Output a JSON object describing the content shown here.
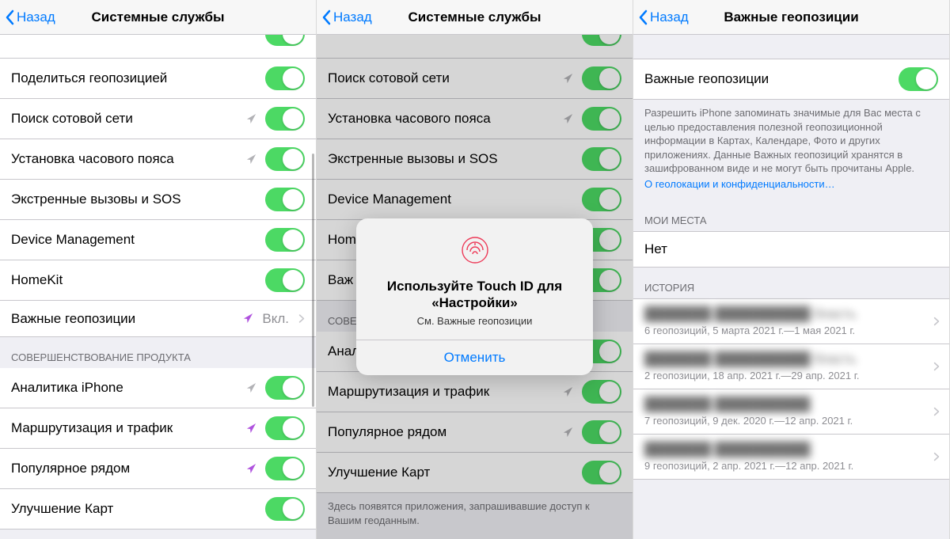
{
  "back_label": "Назад",
  "panel1": {
    "title": "Системные службы",
    "rows": [
      {
        "label": "Поделиться геопозицией",
        "arrow": false,
        "arrowColor": ""
      },
      {
        "label": "Поиск сотовой сети",
        "arrow": true,
        "arrowColor": "gray"
      },
      {
        "label": "Установка часового пояса",
        "arrow": true,
        "arrowColor": "gray"
      },
      {
        "label": "Экстренные вызовы и SOS",
        "arrow": false,
        "arrowColor": ""
      },
      {
        "label": "Device Management",
        "arrow": false,
        "arrowColor": ""
      },
      {
        "label": "HomeKit",
        "arrow": false,
        "arrowColor": ""
      }
    ],
    "significant": {
      "label": "Важные геопозиции",
      "value": "Вкл."
    },
    "section2_header": "СОВЕРШЕНСТВОВАНИЕ ПРОДУКТА",
    "rows2": [
      {
        "label": "Аналитика iPhone",
        "arrow": true,
        "arrowColor": "gray"
      },
      {
        "label": "Маршрутизация и трафик",
        "arrow": true,
        "arrowColor": "purple"
      },
      {
        "label": "Популярное рядом",
        "arrow": true,
        "arrowColor": "purple"
      },
      {
        "label": "Улучшение Карт",
        "arrow": false,
        "arrowColor": ""
      }
    ]
  },
  "panel2": {
    "title": "Системные службы",
    "rows": [
      {
        "label": "Поиск сотовой сети",
        "arrow": true,
        "arrowColor": "gray"
      },
      {
        "label": "Установка часового пояса",
        "arrow": true,
        "arrowColor": "gray"
      },
      {
        "label": "Экстренные вызовы и SOS",
        "arrow": false,
        "arrowColor": ""
      },
      {
        "label": "Device Management",
        "arrow": false,
        "arrowColor": ""
      },
      {
        "label": "Hom",
        "arrow": false,
        "arrowColor": ""
      },
      {
        "label": "Важ",
        "arrow": false,
        "arrowColor": ""
      }
    ],
    "section2_header": "СОВЕ",
    "rows2": [
      {
        "label": "Анал",
        "arrow": false,
        "arrowColor": ""
      },
      {
        "label": "Маршрутизация и трафик",
        "arrow": true,
        "arrowColor": "gray"
      },
      {
        "label": "Популярное рядом",
        "arrow": true,
        "arrowColor": "gray"
      },
      {
        "label": "Улучшение Карт",
        "arrow": false,
        "arrowColor": ""
      }
    ],
    "footer": "Здесь появятся приложения, запрашивавшие доступ к Вашим геоданным.",
    "alert_title": "Используйте Touch ID для «Настройки»",
    "alert_sub": "См. Важные геопозиции",
    "alert_cancel": "Отменить"
  },
  "panel3": {
    "title": "Важные геопозиции",
    "toggle_label": "Важные геопозиции",
    "desc": "Разрешить iPhone запоминать значимые для Вас места с целью предоставления полезной геопозиционной информации в Картах, Календаре, Фото и других приложениях. Данные Важных геопозиций хранятся в зашифрованном виде и не могут быть прочитаны Apple.",
    "desc_link": "О геолокации и конфиденциальности…",
    "places_header": "МОИ МЕСТА",
    "places_none": "Нет",
    "history_header": "ИСТОРИЯ",
    "history": [
      {
        "title_suffix": "бласть",
        "sub": "6 геопозиций, 5 марта 2021 г.—1 мая 2021 г."
      },
      {
        "title_suffix": "бласть",
        "sub": "2 геопозиции, 18 апр. 2021 г.—29 апр. 2021 г."
      },
      {
        "title_suffix": "",
        "sub": "7 геопозиций, 9 дек. 2020 г.—12 апр. 2021 г."
      },
      {
        "title_suffix": "",
        "sub": "9 геопозиций, 2 апр. 2021 г.—12 апр. 2021 г."
      }
    ]
  }
}
